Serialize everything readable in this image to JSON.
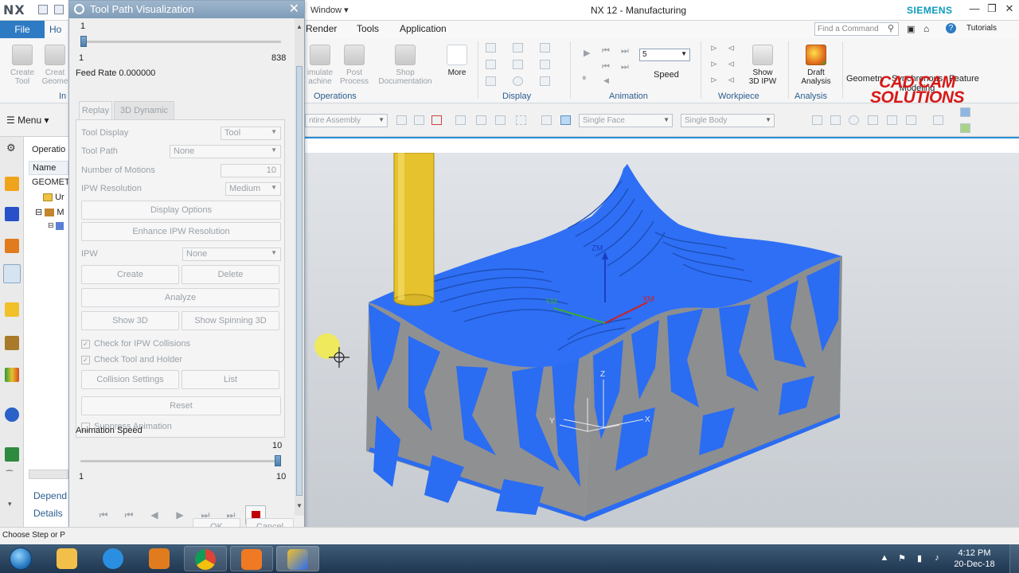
{
  "titlebar": {
    "logo": "NX",
    "window_menu": "Window ▾",
    "app_title": "NX 12 - Manufacturing",
    "brand": "SIEMENS",
    "minimize": "—",
    "restore": "❐",
    "close": "✕"
  },
  "ribbon_tabs": {
    "file": "File",
    "home": "Ho",
    "render": "Render",
    "tools": "Tools",
    "application": "Application",
    "find_placeholder": "Find a Command",
    "tutorials": "Tutorials"
  },
  "ribbon": {
    "create_tool": "Create\nTool",
    "create_geom": "Creat\nGeome",
    "in_label": "In",
    "simulate": "imulate\nachine",
    "post_process": "Post\nProcess",
    "shop_doc": "Shop\nDocumentation",
    "more": "More",
    "operations": "Operations",
    "display": "Display",
    "speed_value": "5",
    "speed": "Speed",
    "animation": "Animation",
    "show_ipw": "Show\n3D IPW",
    "workpiece": "Workpiece",
    "draft": "Draft\nAnalysis",
    "analysis": "Analysis",
    "geometry": "Geometry",
    "sync": "Synchronous\nModeling",
    "feature": "Feature",
    "watermark_line1": "CAD CAM",
    "watermark_line2": "SOLUTIONS"
  },
  "cmdbar": {
    "menu": "Menu ▾",
    "assembly_filter": "ntire Assembly",
    "face_rule": "Single Face",
    "body_rule": "Single Body"
  },
  "navigator": {
    "title": "Operatio",
    "header": "Name",
    "geomet": "GEOMET",
    "row1": "Ur",
    "row2": "M",
    "depend": "Depend",
    "details": "Details"
  },
  "viewport": {
    "axis_zm": "ZM",
    "axis_xm": "XM",
    "axis_ym": "YM",
    "axis_z": "Z",
    "axis_x": "X",
    "axis_y": "Y"
  },
  "dialog": {
    "title": "Tool Path Visualization",
    "slider_value": "1",
    "slider_min": "1",
    "slider_max": "838",
    "slider_fraction": 0.0,
    "feed_rate": "Feed Rate 0.000000",
    "tab_replay": "Replay",
    "tab_3d": "3D Dynamic",
    "tool_display_label": "Tool Display",
    "tool_display_value": "Tool",
    "tool_path_label": "Tool Path",
    "tool_path_value": "None",
    "num_motions_label": "Number of Motions",
    "num_motions_value": "10",
    "ipw_res_label": "IPW Resolution",
    "ipw_res_value": "Medium",
    "display_options": "Display Options",
    "enhance_ipw": "Enhance IPW Resolution",
    "ipw_label": "IPW",
    "ipw_value": "None",
    "create": "Create",
    "delete": "Delete",
    "analyze": "Analyze",
    "show_3d": "Show 3D",
    "show_spinning": "Show Spinning 3D",
    "check_ipw": "Check for IPW Collisions",
    "check_tool": "Check Tool and Holder",
    "collision_settings": "Collision Settings",
    "list": "List",
    "reset": "Reset",
    "suppress_anim": "Suppress Animation",
    "anim_speed_label": "Animation Speed",
    "anim_speed_value": "10",
    "anim_min": "1",
    "anim_max": "10",
    "anim_fraction": 1.0,
    "ok": "OK",
    "cancel": "Cancel"
  },
  "statusbar": {
    "text": "Choose Step or P"
  },
  "taskbar": {
    "time": "4:12 PM",
    "date": "20-Dec-18"
  },
  "colors": {
    "accent": "#2e7bc4",
    "part_blue": "#2a6cf2",
    "stock_grey": "#8f9092",
    "tool_yellow": "#e6c22e",
    "stop_red": "#c00000"
  }
}
